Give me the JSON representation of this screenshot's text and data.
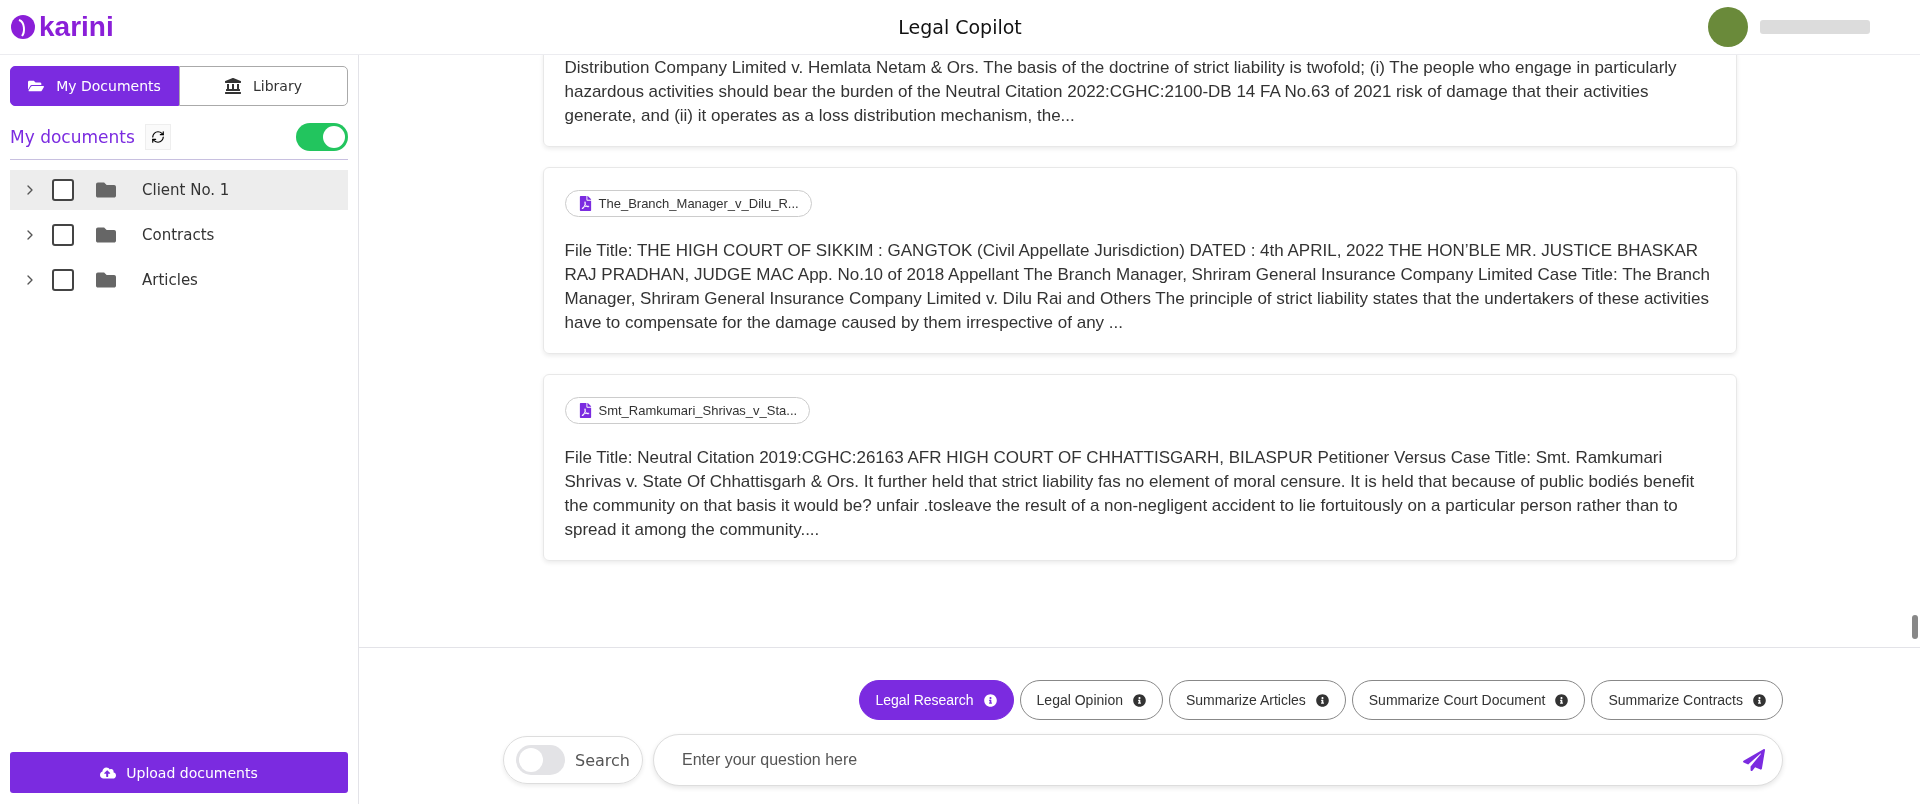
{
  "header": {
    "logo": "karini",
    "title": "Legal Copilot"
  },
  "sidebar": {
    "tabs": [
      {
        "label": "My Documents",
        "selected": true
      },
      {
        "label": "Library",
        "selected": false
      }
    ],
    "section_title": "My documents",
    "sync_toggle": {
      "on": true
    },
    "tree": [
      {
        "label": "Client No. 1",
        "selected": true,
        "checked": false,
        "expanded": false
      },
      {
        "label": "Contracts",
        "selected": false,
        "checked": false,
        "expanded": false
      },
      {
        "label": "Articles",
        "selected": false,
        "checked": false,
        "expanded": false
      }
    ],
    "upload_button": "Upload documents"
  },
  "results": [
    {
      "text": "Distribution Company Limited v. Hemlata Netam & Ors. The basis of the doctrine of strict liability is twofold; (i) The people who engage in particularly hazardous activities should bear the burden of the Neutral Citation 2022:CGHC:2100-DB 14 FA No.63 of 2021 risk of damage that their activities generate, and (ii) it operates as a loss distribution mechanism, the..."
    },
    {
      "file": "The_Branch_Manager_v_Dilu_R...",
      "text": "File Title: THE HIGH COURT OF SIKKIM : GANGTOK (Civil Appellate Jurisdiction) DATED : 4th APRIL, 2022 THE HON’BLE MR. JUSTICE BHASKAR RAJ PRADHAN, JUDGE MAC App. No.10 of 2018 Appellant The Branch Manager, Shriram General Insurance Company Limited Case Title: The Branch Manager, Shriram General Insurance Company Limited v. Dilu Rai and Others The principle of strict liability states that the undertakers of these activities have to compensate for the damage caused by them irrespective of any ..."
    },
    {
      "file": "Smt_Ramkumari_Shrivas_v_Sta...",
      "text": "File Title: Neutral Citation 2019:CGHC:26163 AFR HIGH COURT OF CHHATTISGARH, BILASPUR Petitioner Versus Case Title: Smt. Ramkumari Shrivas v. State Of Chhattisgarh & Ors. It further held that strict liability fas no element of moral censure. It is held that because of public bodiés benefit the community on that basis it would be? unfair .tosleave the result of a non-negligent accident to lie fortuitously on a particular person rather than to spread it among the community...."
    }
  ],
  "modes": [
    {
      "label": "Legal Research",
      "selected": true
    },
    {
      "label": "Legal Opinion",
      "selected": false
    },
    {
      "label": "Summarize Articles",
      "selected": false
    },
    {
      "label": "Summarize Court Document",
      "selected": false
    },
    {
      "label": "Summarize Contracts",
      "selected": false
    }
  ],
  "search_toggle": {
    "label": "Search",
    "on": false
  },
  "question": {
    "placeholder": "Enter your question here"
  }
}
